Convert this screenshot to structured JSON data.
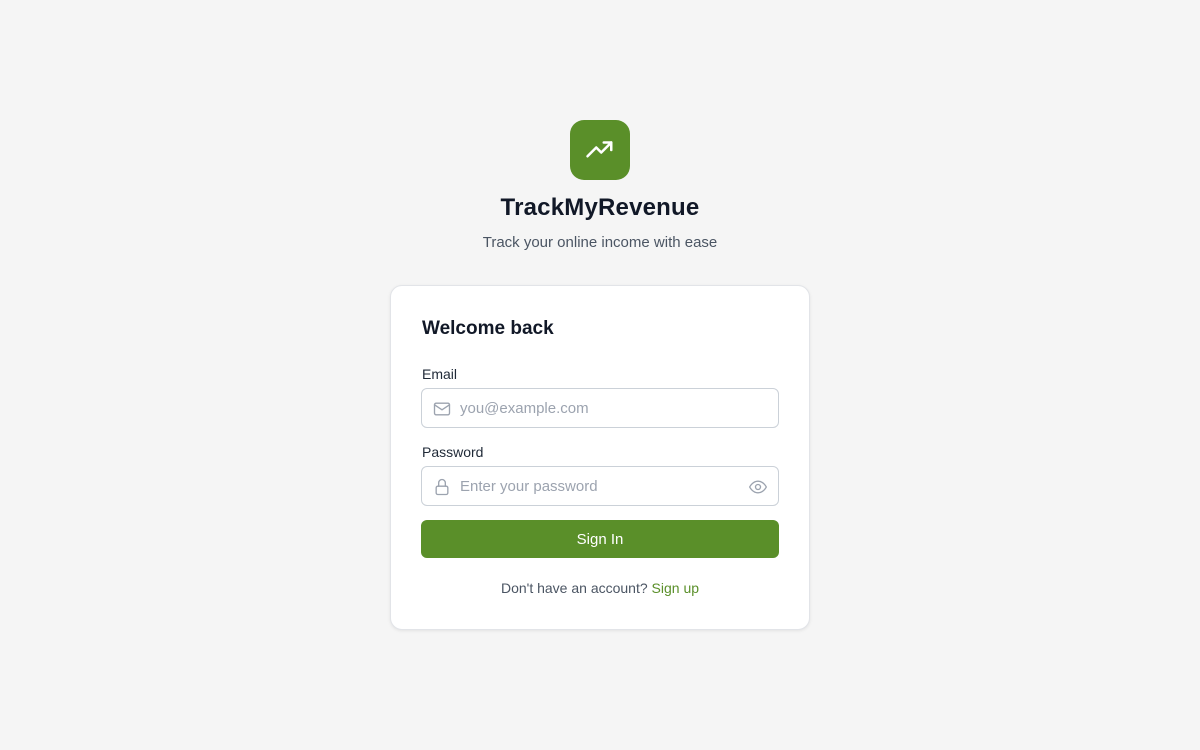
{
  "brand": {
    "name": "TrackMyRevenue",
    "tagline": "Track your online income with ease",
    "logo_icon": "trending-up-icon",
    "accent_color": "#5a8f29"
  },
  "login_form": {
    "title": "Welcome back",
    "email": {
      "label": "Email",
      "placeholder": "you@example.com",
      "value": "",
      "icon": "mail-icon"
    },
    "password": {
      "label": "Password",
      "placeholder": "Enter your password",
      "value": "",
      "icon": "lock-icon",
      "toggle_icon": "eye-icon"
    },
    "submit_label": "Sign In",
    "signup_prompt": "Don't have an account?",
    "signup_link": "Sign up"
  }
}
